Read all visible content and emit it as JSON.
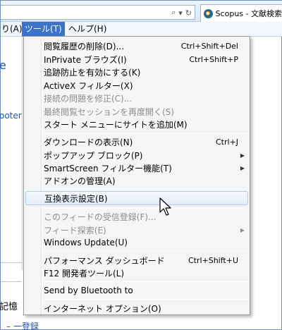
{
  "address": {
    "icons": {
      "search": "⌕",
      "dropdown": "▾",
      "refresh": "↻"
    }
  },
  "tab": {
    "title": "Scopus - 文献検索"
  },
  "menubar": {
    "items": [
      {
        "label": "り(A)"
      },
      {
        "label": "ツール(T)",
        "active": true
      },
      {
        "label": "ヘルプ(H)"
      }
    ]
  },
  "page": {
    "link_fragment": "ooter",
    "text_fragment": "記憶",
    "link_bottom": "一登録"
  },
  "menu": {
    "items": [
      {
        "label": "閲覧履歴の削除(D)...",
        "shortcut": "Ctrl+Shift+Del"
      },
      {
        "label": "InPrivate ブラウズ(I)",
        "shortcut": "Ctrl+Shift+P"
      },
      {
        "label": "追跡防止を有効にする(K)",
        "shortcut": ""
      },
      {
        "label": "ActiveX フィルター(X)",
        "shortcut": ""
      },
      {
        "label": "接続の問題を修正(C)...",
        "shortcut": "",
        "disabled": true
      },
      {
        "label": "最終閲覧セッションを再度開く(S)",
        "shortcut": "",
        "disabled": true
      },
      {
        "label": "スタート メニューにサイトを追加(M)",
        "shortcut": ""
      },
      {
        "label": "ダウンロードの表示(N)",
        "shortcut": "Ctrl+J"
      },
      {
        "label": "ポップアップ ブロック(P)",
        "shortcut": "",
        "submenu": true
      },
      {
        "label": "SmartScreen フィルター機能(T)",
        "shortcut": "",
        "submenu": true
      },
      {
        "label": "アドオンの管理(A)",
        "shortcut": ""
      },
      {
        "label": "互換表示設定(B)",
        "shortcut": "",
        "hover": true
      },
      {
        "label": "このフィードの受信登録(F)...",
        "shortcut": "",
        "disabled": true
      },
      {
        "label": "フィード探索(E)",
        "shortcut": "",
        "disabled": true,
        "submenu": true
      },
      {
        "label": "Windows Update(U)",
        "shortcut": ""
      },
      {
        "label": "パフォーマンス ダッシュボード",
        "shortcut": "Ctrl+Shift+U"
      },
      {
        "label": "F12 開発者ツール(L)",
        "shortcut": ""
      },
      {
        "label": "Send by Bluetooth to",
        "shortcut": ""
      },
      {
        "label": "インターネット オプション(O)",
        "shortcut": ""
      }
    ],
    "submenu_arrow": "▶"
  },
  "colors": {
    "menu_highlight": "#3b73c8",
    "link": "#1a55b5",
    "disabled_text": "#8d8d8d"
  }
}
